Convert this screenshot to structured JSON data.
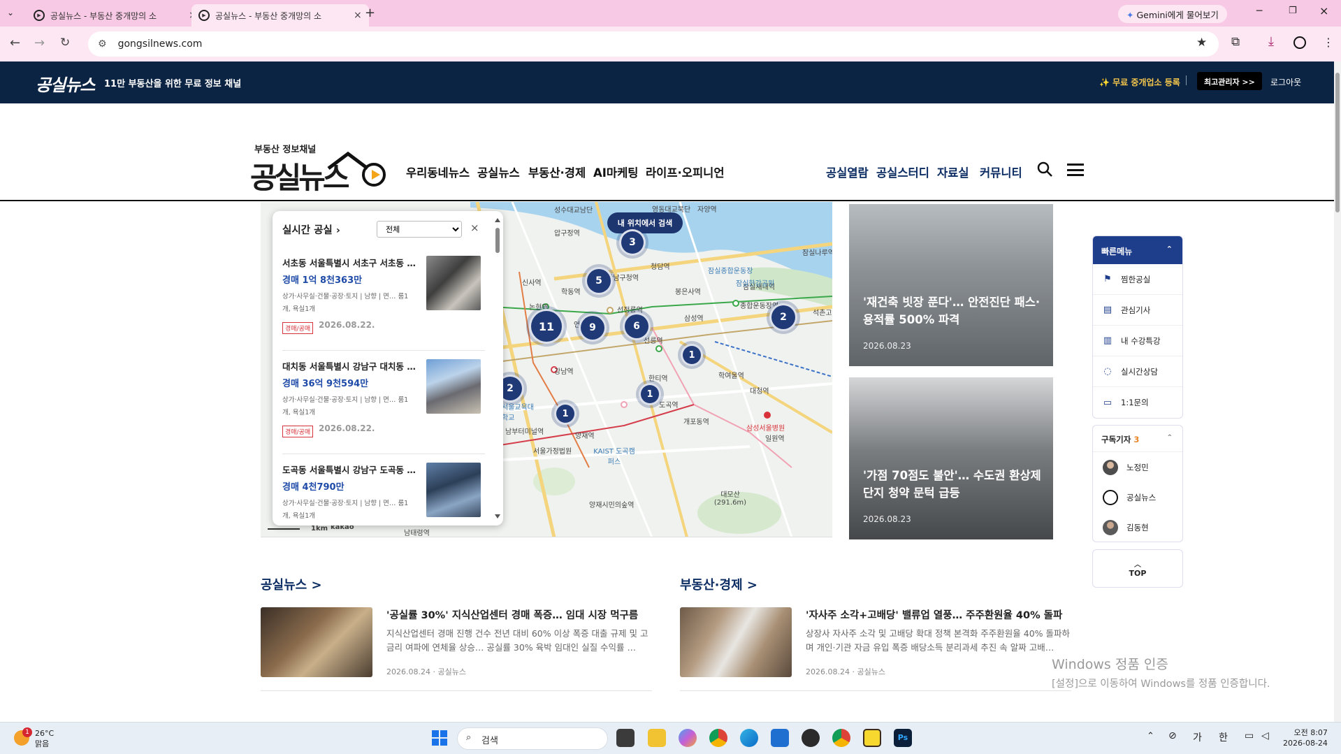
{
  "browser": {
    "tabs": [
      {
        "title": "공실뉴스 - 부동산 중개망의 소"
      },
      {
        "title": "공실뉴스 - 부동산 중개망의 소"
      }
    ],
    "new_tab": "+",
    "gemini_button": "Gemini에게 물어보기",
    "url": "gongsilnews.com"
  },
  "site": {
    "topbar": {
      "logo": "공실뉴스",
      "tagline": "11만 부동산을 위한 무료 정보 채널",
      "register": "✨ 무료 중개업소 등록",
      "admin": "최고관리자 >>",
      "logout": "로그아웃"
    },
    "brand": {
      "subtitle": "부동산 정보채널",
      "name": "공실뉴스"
    },
    "nav_left": [
      "우리동네뉴스",
      "공실뉴스",
      "부동산·경제",
      "AI마케팅",
      "라이프·오피니언"
    ],
    "nav_right": [
      "공실열람",
      "공실스터디",
      "자료실",
      "커뮤니티"
    ]
  },
  "map": {
    "locate_button": "내 위치에서 검색",
    "clusters": [
      "3",
      "5",
      "11",
      "9",
      "6",
      "2",
      "1",
      "2",
      "1",
      "1"
    ],
    "labels": [
      "성수대교남단",
      "압구정역",
      "신사역",
      "논현역",
      "학동역",
      "선정릉역",
      "강남구청역",
      "청담역",
      "봉은사역",
      "잠실종합운동장",
      "종합운동장역",
      "잠실새내역",
      "삼성역",
      "언주역",
      "선릉역",
      "강남역",
      "도곡역",
      "개포동역",
      "학여울역",
      "대청역",
      "일원역",
      "양재역",
      "서울가정법원",
      "KAIST 도곡캠퍼스",
      "대모산 (291.6m)",
      "양재시민의숲역",
      "삼성서울병원",
      "서울교육대학교",
      "남부터미널역",
      "잠실나루역",
      "영동대교북단",
      "자양역",
      "석촌고분",
      "잠실한강공원",
      "한티역",
      "남태령역"
    ],
    "scale": "1km",
    "provider": "kakao"
  },
  "realtime": {
    "title": "실시간 공실",
    "filter": "전체",
    "close": "×",
    "items": [
      {
        "title": "서초동 서울특별시 서초구 서초동 …",
        "price": "경매 1억 8천363만",
        "meta": "상가·사무실·건물·공장·토지 | 남향 | 면… 룸1개, 욕실1개",
        "tag": "경매/공매",
        "date": "2026.08.22."
      },
      {
        "title": "대치동 서울특별시 강남구 대치동 …",
        "price": "경매 36억 9천594만",
        "meta": "상가·사무실·건물·공장·토지 | 남향 | 면… 룸1개, 욕실1개",
        "tag": "경매/공매",
        "date": "2026.08.22."
      },
      {
        "title": "도곡동 서울특별시 강남구 도곡동 …",
        "price": "경매 4천790만",
        "meta": "상가·사무실·건물·공장·토지 | 남향 | 면… 룸1개, 욕실1개",
        "tag": "경매/공매",
        "date": ""
      }
    ]
  },
  "features": [
    {
      "title": "'재건축 빗장 푼다'… 안전진단 패스·용적률 500% 파격",
      "date": "2026.08.23"
    },
    {
      "title": "'가점 70점도 불안'… 수도권 환상제단지 청약 문턱 급등",
      "date": "2026.08.23"
    }
  ],
  "quick_menu": {
    "title": "빠른메뉴",
    "items": [
      {
        "icon": "bookmark-icon",
        "label": "찜한공실"
      },
      {
        "icon": "article-icon",
        "label": "관심기사"
      },
      {
        "icon": "book-icon",
        "label": "내 수강특강"
      },
      {
        "icon": "chat-icon",
        "label": "실시간상담"
      },
      {
        "icon": "message-icon",
        "label": "1:1문의"
      }
    ]
  },
  "subscriptions": {
    "title": "구독기자",
    "count": "3",
    "items": [
      "노정민",
      "공실뉴스",
      "김동현"
    ]
  },
  "top_button": "TOP",
  "sections": [
    {
      "title": "공실뉴스 >",
      "headline": "'공실률 30%' 지식산업센터 경매 폭증… 임대 시장 먹구름",
      "summary": "지식산업센터 경매 진행 건수 전년 대비 60% 이상 폭증 대출 규제 및 고금리 여파에 연체율 상승… 공실률 30% 육박 임대인 실질 수익률 …",
      "meta": "2026.08.24 · 공실뉴스"
    },
    {
      "title": "부동산·경제 >",
      "headline": "'자사주 소각+고배당' 밸류업 열풍… 주주환원율 40% 돌파",
      "summary": "상장사 자사주 소각 및 고배당 확대 정책 본격화 주주환원율 40% 돌파하며 개인·기관 자금 유입 폭증 배당소득 분리과세 추진 속 알짜 고배…",
      "meta": "2026.08.24 · 공실뉴스"
    }
  ],
  "windows_activation": {
    "title": "Windows 정품 인증",
    "body": "[설정]으로 이동하여 Windows를 정품 인증합니다."
  },
  "taskbar": {
    "temp": "26°C",
    "weather": "맑음",
    "badge": "1",
    "search": "검색",
    "ime1": "가",
    "ime2": "한",
    "time": "오전 8:07",
    "date": "2026-08-24"
  }
}
